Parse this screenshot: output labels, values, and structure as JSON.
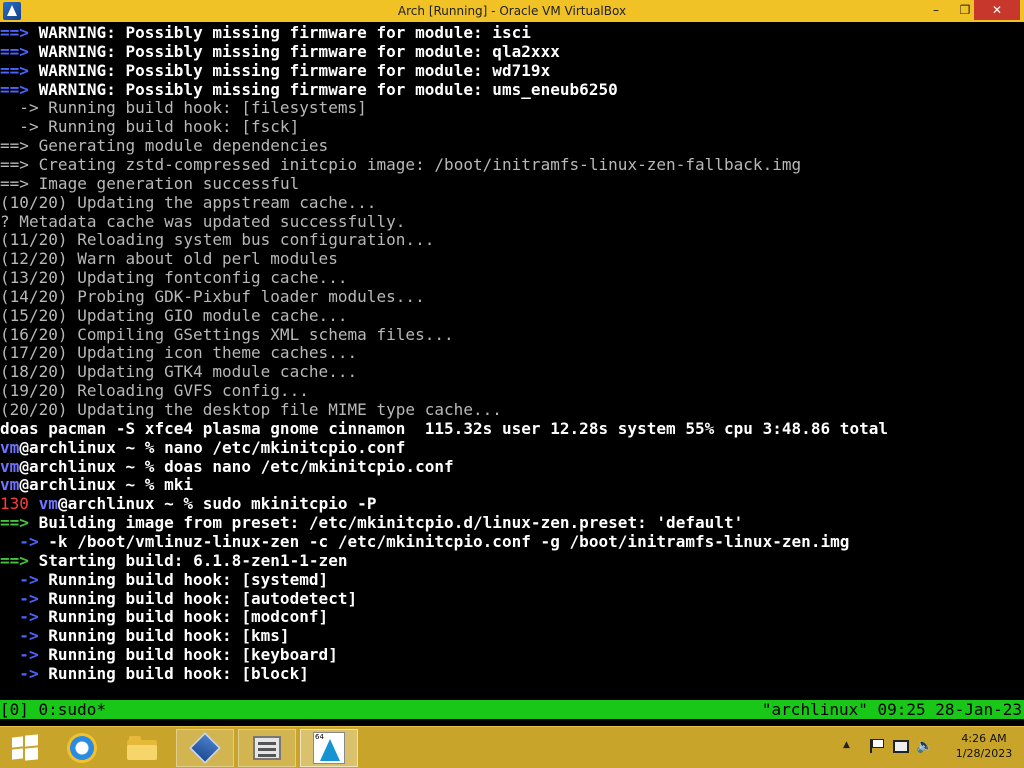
{
  "window": {
    "title": "Arch [Running] - Oracle VM VirtualBox",
    "minimize_label": "–",
    "maximize_label": "❐",
    "close_label": "✕"
  },
  "terminal": {
    "lines": [
      {
        "segments": [
          {
            "text": "==> ",
            "style": "blue"
          },
          {
            "text": "WARNING: Possibly missing firmware for module: isci",
            "style": "hl"
          }
        ]
      },
      {
        "segments": [
          {
            "text": "==> ",
            "style": "blue"
          },
          {
            "text": "WARNING: Possibly missing firmware for module: qla2xxx",
            "style": "hl"
          }
        ]
      },
      {
        "segments": [
          {
            "text": "==> ",
            "style": "blue"
          },
          {
            "text": "WARNING: Possibly missing firmware for module: wd719x",
            "style": "hl"
          }
        ]
      },
      {
        "segments": [
          {
            "text": "==> ",
            "style": "blue"
          },
          {
            "text": "WARNING: Possibly missing firmware for module: ums_eneub6250",
            "style": "hl"
          }
        ]
      },
      {
        "segments": [
          {
            "text": "  -> ",
            "style": "plain"
          },
          {
            "text": "Running build hook: [filesystems]",
            "style": "plain"
          }
        ]
      },
      {
        "segments": [
          {
            "text": "  -> ",
            "style": "plain"
          },
          {
            "text": "Running build hook: [fsck]",
            "style": "plain"
          }
        ]
      },
      {
        "segments": [
          {
            "text": "==> ",
            "style": "plain"
          },
          {
            "text": "Generating module dependencies",
            "style": "plain"
          }
        ]
      },
      {
        "segments": [
          {
            "text": "==> ",
            "style": "plain"
          },
          {
            "text": "Creating zstd-compressed initcpio image: /boot/initramfs-linux-zen-fallback.img",
            "style": "plain"
          }
        ]
      },
      {
        "segments": [
          {
            "text": "==> ",
            "style": "plain"
          },
          {
            "text": "Image generation successful",
            "style": "plain"
          }
        ]
      },
      {
        "segments": [
          {
            "text": "(10/20) Updating the appstream cache...",
            "style": "plain"
          }
        ]
      },
      {
        "segments": [
          {
            "text": "? Metadata cache was updated successfully.",
            "style": "plain"
          }
        ]
      },
      {
        "segments": [
          {
            "text": "(11/20) Reloading system bus configuration...",
            "style": "plain"
          }
        ]
      },
      {
        "segments": [
          {
            "text": "(12/20) Warn about old perl modules",
            "style": "plain"
          }
        ]
      },
      {
        "segments": [
          {
            "text": "(13/20) Updating fontconfig cache...",
            "style": "plain"
          }
        ]
      },
      {
        "segments": [
          {
            "text": "(14/20) Probing GDK-Pixbuf loader modules...",
            "style": "plain"
          }
        ]
      },
      {
        "segments": [
          {
            "text": "(15/20) Updating GIO module cache...",
            "style": "plain"
          }
        ]
      },
      {
        "segments": [
          {
            "text": "(16/20) Compiling GSettings XML schema files...",
            "style": "plain"
          }
        ]
      },
      {
        "segments": [
          {
            "text": "(17/20) Updating icon theme caches...",
            "style": "plain"
          }
        ]
      },
      {
        "segments": [
          {
            "text": "(18/20) Updating GTK4 module cache...",
            "style": "plain"
          }
        ]
      },
      {
        "segments": [
          {
            "text": "(19/20) Reloading GVFS config...",
            "style": "plain"
          }
        ]
      },
      {
        "segments": [
          {
            "text": "(20/20) Updating the desktop file MIME type cache...",
            "style": "plain"
          }
        ]
      },
      {
        "segments": [
          {
            "text": "doas pacman -S xfce4 plasma gnome cinnamon  115.32s user 12.28s system 55% cpu 3:48.86 total",
            "style": "hl"
          }
        ]
      },
      {
        "segments": [
          {
            "text": "vm",
            "style": "vm"
          },
          {
            "text": "@archlinux ~ % nano /etc/mkinitcpio.conf",
            "style": "hl"
          }
        ]
      },
      {
        "segments": [
          {
            "text": "vm",
            "style": "vm"
          },
          {
            "text": "@archlinux ~ % doas nano /etc/mkinitcpio.conf",
            "style": "hl"
          }
        ]
      },
      {
        "segments": [
          {
            "text": "vm",
            "style": "vm"
          },
          {
            "text": "@archlinux ~ % mki",
            "style": "hl"
          }
        ]
      },
      {
        "segments": [
          {
            "text": "130 ",
            "style": "red"
          },
          {
            "text": "vm",
            "style": "vm"
          },
          {
            "text": "@archlinux ~ % sudo mkinitcpio -P",
            "style": "hl"
          }
        ]
      },
      {
        "segments": [
          {
            "text": "==> ",
            "style": "green"
          },
          {
            "text": "Building image from preset: /etc/mkinitcpio.d/linux-zen.preset: 'default'",
            "style": "hl"
          }
        ]
      },
      {
        "segments": [
          {
            "text": "  -> ",
            "style": "blue"
          },
          {
            "text": "-k /boot/vmlinuz-linux-zen -c /etc/mkinitcpio.conf -g /boot/initramfs-linux-zen.img",
            "style": "hl"
          }
        ]
      },
      {
        "segments": [
          {
            "text": "==> ",
            "style": "green"
          },
          {
            "text": "Starting build: 6.1.8-zen1-1-zen",
            "style": "hl"
          }
        ]
      },
      {
        "segments": [
          {
            "text": "  -> ",
            "style": "blue"
          },
          {
            "text": "Running build hook: [systemd]",
            "style": "hl"
          }
        ]
      },
      {
        "segments": [
          {
            "text": "  -> ",
            "style": "blue"
          },
          {
            "text": "Running build hook: [autodetect]",
            "style": "hl"
          }
        ]
      },
      {
        "segments": [
          {
            "text": "  -> ",
            "style": "blue"
          },
          {
            "text": "Running build hook: [modconf]",
            "style": "hl"
          }
        ]
      },
      {
        "segments": [
          {
            "text": "  -> ",
            "style": "blue"
          },
          {
            "text": "Running build hook: [kms]",
            "style": "hl"
          }
        ]
      },
      {
        "segments": [
          {
            "text": "  -> ",
            "style": "blue"
          },
          {
            "text": "Running build hook: [keyboard]",
            "style": "hl"
          }
        ]
      },
      {
        "segments": [
          {
            "text": "  -> ",
            "style": "blue"
          },
          {
            "text": "Running build hook: [block]",
            "style": "hl"
          }
        ]
      }
    ]
  },
  "tmux": {
    "left": "[0] 0:sudo*",
    "right": "\"archlinux\" 09:25 28-Jan-23",
    "color": "#19c719"
  },
  "taskbar": {
    "color": "#c9a42a",
    "vbox_badge": "64",
    "clock_time": "4:26 AM",
    "clock_date": "1/28/2023"
  },
  "colors": {
    "titlebar": "#f0c226",
    "close_button": "#c7372c",
    "console_bg": "#000000",
    "prompt_user": "#6f73ff",
    "arrow_blue": "#4b64ff",
    "arrow_green": "#43c33a",
    "exit_code": "#ff3b3b"
  },
  "icons": [
    "virtualbox-icon",
    "windows-start-icon",
    "internet-explorer-icon",
    "file-explorer-icon",
    "virtualbox-taskbar-icon",
    "virtualbox-manager-icon",
    "arch-vm-icon",
    "show-hidden-icons-icon",
    "action-center-flag-icon",
    "network-icon",
    "speaker-icon"
  ]
}
